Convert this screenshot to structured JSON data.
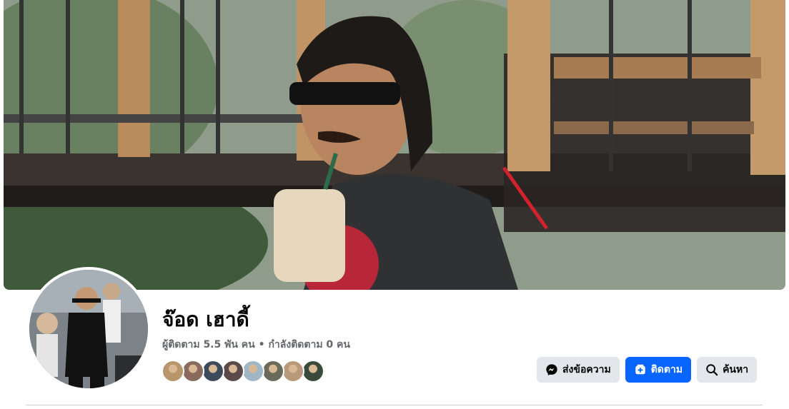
{
  "profile": {
    "name": "จ๊อด เฮาดี้",
    "followers_text": "ผู้ติดตาม 5.5 พัน คน",
    "separator": " • ",
    "following_text": "กำลังติดตาม 0 คน"
  },
  "cover": {
    "description_icon": "cover-photo"
  },
  "friends": [
    {
      "color": "#b8956a"
    },
    {
      "color": "#8a6a5c"
    },
    {
      "color": "#3d4a5c"
    },
    {
      "color": "#5a4a4a"
    },
    {
      "color": "#9fb7c4"
    },
    {
      "color": "#6a6a5a"
    },
    {
      "color": "#b89a7a"
    },
    {
      "color": "#3a4a3a"
    }
  ],
  "actions": {
    "message_label": "ส่งข้อความ",
    "follow_label": "ติดตาม",
    "search_label": "ค้นหา"
  },
  "colors": {
    "primary": "#0866ff",
    "secondary_bg": "#e4e6eb",
    "muted_text": "#65676b"
  }
}
